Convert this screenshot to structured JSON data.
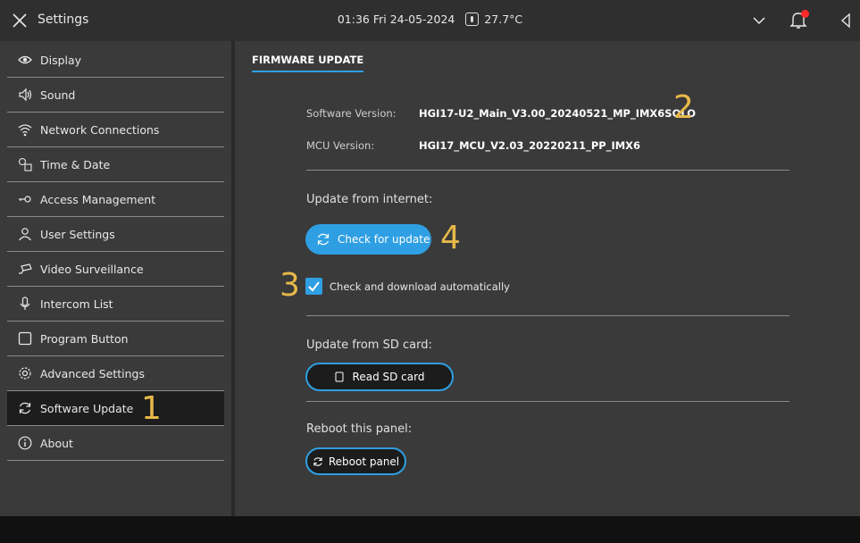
{
  "topbar": {
    "title": "Settings",
    "time": "01:36",
    "date": "Fri 24-05-2024",
    "temperature": "27.7°C",
    "icons": [
      "close-icon",
      "thermometer-icon",
      "chevron-down-icon",
      "bell-icon",
      "volume-icon"
    ],
    "notification_color": "#ff2a2a"
  },
  "sidebar": {
    "items": [
      {
        "label": "Display",
        "icon": "eye-icon"
      },
      {
        "label": "Sound",
        "icon": "speaker-icon"
      },
      {
        "label": "Network Connections",
        "icon": "wifi-icon"
      },
      {
        "label": "Time & Date",
        "icon": "clock-calendar-icon"
      },
      {
        "label": "Access Management",
        "icon": "key-icon"
      },
      {
        "label": "User Settings",
        "icon": "user-icon"
      },
      {
        "label": "Video Surveillance",
        "icon": "camera-icon"
      },
      {
        "label": "Intercom List",
        "icon": "microphone-icon"
      },
      {
        "label": "Program Button",
        "icon": "square-icon"
      },
      {
        "label": "Advanced Settings",
        "icon": "gear-icon"
      },
      {
        "label": "Software Update",
        "icon": "refresh-icon"
      },
      {
        "label": "About",
        "icon": "info-icon"
      }
    ],
    "active": "Software Update"
  },
  "content": {
    "tab": "FIRMWARE UPDATE",
    "software_version_label": "Software Version:",
    "software_version_value": "HGI17-U2_Main_V3.00_20240521_MP_IMX6SOLO",
    "mcu_version_label": "MCU Version:",
    "mcu_version_value": "HGI17_MCU_V2.03_20220211_PP_IMX6",
    "internet_section": "Update from internet:",
    "check_button": "Check for update",
    "auto_checkbox_label": "Check and download automatically",
    "auto_checked": true,
    "sd_section": "Update from SD card:",
    "sd_button": "Read SD card",
    "reboot_section": "Reboot this panel:",
    "reboot_button": "Reboot panel"
  },
  "callouts": [
    "1",
    "2",
    "3",
    "4"
  ],
  "colors": {
    "accent": "#2f9fe3",
    "callout": "#e7b94a",
    "background": "#3a3a3a"
  }
}
